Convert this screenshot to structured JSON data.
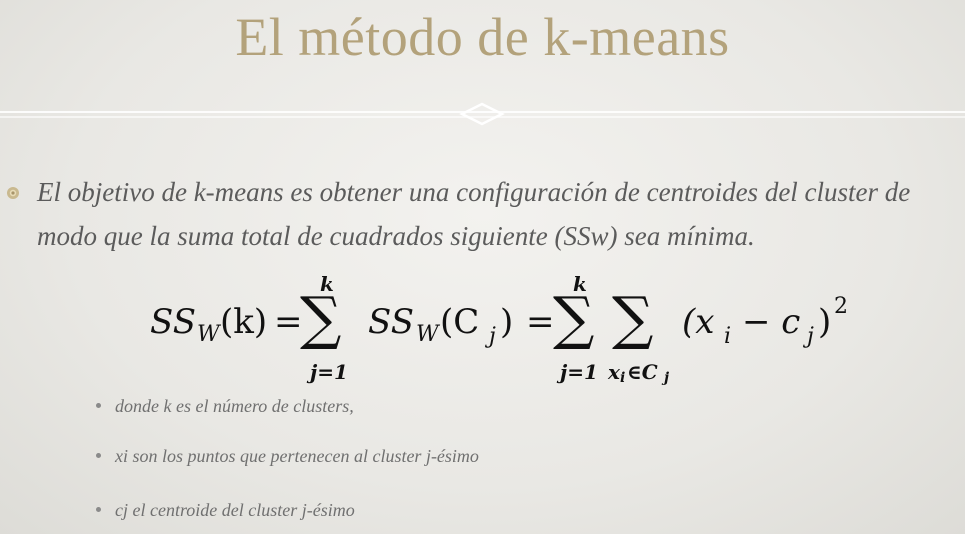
{
  "slide": {
    "title": "El método de k-means",
    "main_bullet": "El objetivo de k-means es obtener una configuración de centroides del cluster de modo que la suma total de cuadrados siguiente (SSw) sea mínima.",
    "formula": {
      "lhs_ss": "SS",
      "lhs_sub": "W",
      "lhs_arg": "(k)",
      "eq1": "=",
      "sum1_upper": "k",
      "sum1_lower": "j=1",
      "mid_ss": "SS",
      "mid_sub": "W",
      "mid_arg": "(C",
      "mid_arg_sub": "j",
      "mid_close": ")",
      "eq2": "=",
      "sum2_upper": "k",
      "sum2_lower": "j=1",
      "sum3_lower": "x",
      "sum3_lower_sub": "i",
      "sum3_lower_rest": "∈C",
      "sum3_lower_rest_sub": "j",
      "term_open": "(x",
      "term_x_sub": "i",
      "term_minus": "− c",
      "term_c_sub": "j",
      "term_close": ")",
      "exponent": "2"
    },
    "sub_bullets": [
      "donde k es el número de clusters,",
      "xi son los puntos que pertenecen al  cluster j-ésimo",
      "cj el centroide del cluster j-ésimo"
    ]
  }
}
